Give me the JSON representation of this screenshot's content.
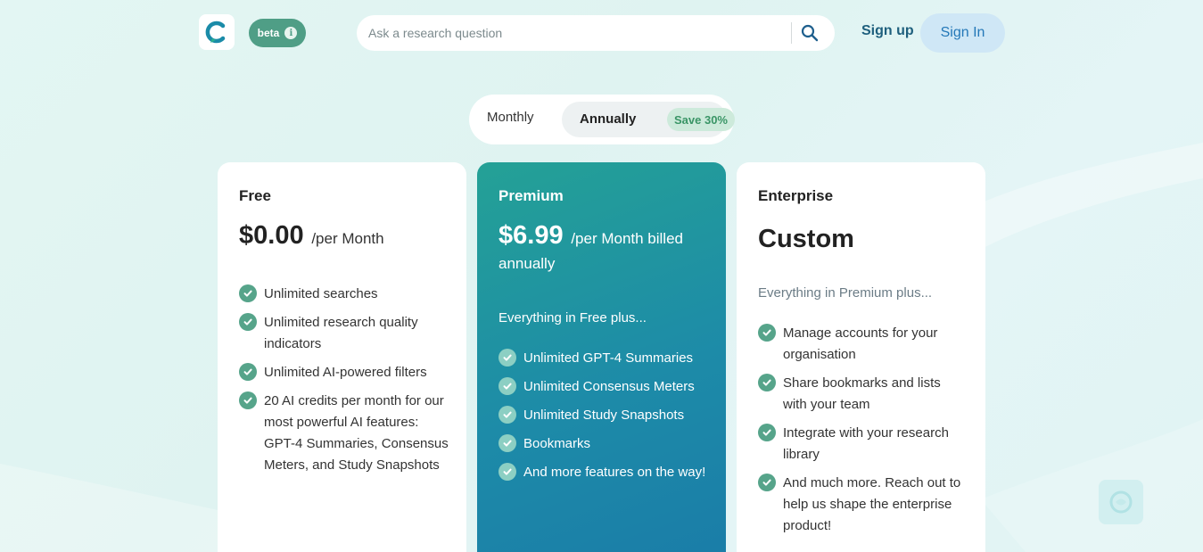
{
  "header": {
    "beta_label": "beta",
    "search_placeholder": "Ask a research question",
    "signup_label": "Sign up",
    "signin_label": "Sign In"
  },
  "billing": {
    "monthly_label": "Monthly",
    "annually_label": "Annually",
    "save_label": "Save 30%",
    "selected": "Annually"
  },
  "plans": {
    "free": {
      "name": "Free",
      "price": "$0.00",
      "period": "/per Month",
      "features": [
        "Unlimited searches",
        "Unlimited research quality indicators",
        "Unlimited AI-powered filters",
        "20 AI credits per month for our most powerful AI features: GPT-4 Summaries, Consensus Meters, and Study Snapshots"
      ]
    },
    "premium": {
      "name": "Premium",
      "price": "$6.99",
      "period": "/per Month billed annually",
      "intro": "Everything in Free plus...",
      "features": [
        "Unlimited GPT-4 Summaries",
        "Unlimited Consensus Meters",
        "Unlimited Study Snapshots",
        "Bookmarks",
        "And more features on the way!"
      ]
    },
    "enterprise": {
      "name": "Enterprise",
      "price": "Custom",
      "intro": "Everything in Premium plus...",
      "features": [
        "Manage accounts for your organisation",
        "Share bookmarks and lists with your team",
        "Integrate with your research library",
        "And much more. Reach out to help us shape the enterprise product!"
      ]
    }
  },
  "colors": {
    "accent_green": "#4f9e86",
    "premium_gradient_start": "#24a196",
    "premium_gradient_end": "#1a7ca8",
    "signin_bg": "#cfe7f6",
    "signup_text": "#1e5f7d"
  },
  "icons": {
    "logo": "consensus-logo-icon",
    "info": "info-icon",
    "search": "search-icon",
    "check": "check-circle-icon",
    "chat": "chat-widget-icon"
  }
}
